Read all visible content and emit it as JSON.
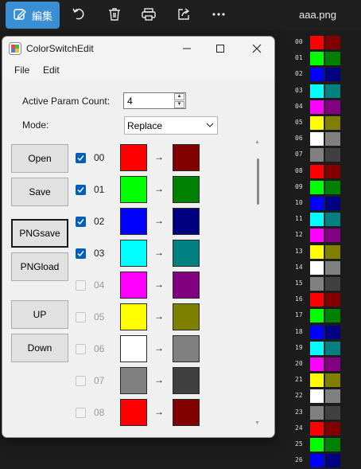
{
  "toolbar": {
    "edit_label": "編集",
    "filename": "aaa.png",
    "icons": [
      "edit-icon",
      "rotate-icon",
      "delete-icon",
      "print-icon",
      "share-icon",
      "more-icon"
    ]
  },
  "strip": {
    "rows": [
      {
        "num": "00",
        "a": "#ff0000",
        "b": "#800000"
      },
      {
        "num": "01",
        "a": "#00ff00",
        "b": "#008000"
      },
      {
        "num": "02",
        "a": "#0000ff",
        "b": "#000080"
      },
      {
        "num": "03",
        "a": "#00ffff",
        "b": "#008080"
      },
      {
        "num": "04",
        "a": "#ff00ff",
        "b": "#800080"
      },
      {
        "num": "05",
        "a": "#ffff00",
        "b": "#808000"
      },
      {
        "num": "06",
        "a": "#ffffff",
        "b": "#808080"
      },
      {
        "num": "07",
        "a": "#808080",
        "b": "#404040"
      },
      {
        "num": "08",
        "a": "#ff0000",
        "b": "#800000"
      },
      {
        "num": "09",
        "a": "#00ff00",
        "b": "#008000"
      },
      {
        "num": "10",
        "a": "#0000ff",
        "b": "#000080"
      },
      {
        "num": "11",
        "a": "#00ffff",
        "b": "#008080"
      },
      {
        "num": "12",
        "a": "#ff00ff",
        "b": "#800080"
      },
      {
        "num": "13",
        "a": "#ffff00",
        "b": "#808000"
      },
      {
        "num": "14",
        "a": "#ffffff",
        "b": "#808080"
      },
      {
        "num": "15",
        "a": "#808080",
        "b": "#404040"
      },
      {
        "num": "16",
        "a": "#ff0000",
        "b": "#800000"
      },
      {
        "num": "17",
        "a": "#00ff00",
        "b": "#008000"
      },
      {
        "num": "18",
        "a": "#0000ff",
        "b": "#000080"
      },
      {
        "num": "19",
        "a": "#00ffff",
        "b": "#008080"
      },
      {
        "num": "20",
        "a": "#ff00ff",
        "b": "#800080"
      },
      {
        "num": "21",
        "a": "#ffff00",
        "b": "#808000"
      },
      {
        "num": "22",
        "a": "#ffffff",
        "b": "#808080"
      },
      {
        "num": "23",
        "a": "#808080",
        "b": "#404040"
      },
      {
        "num": "24",
        "a": "#ff0000",
        "b": "#800000"
      },
      {
        "num": "25",
        "a": "#00ff00",
        "b": "#008000"
      },
      {
        "num": "26",
        "a": "#0000ff",
        "b": "#000080"
      }
    ]
  },
  "window": {
    "title": "ColorSwitchEdit",
    "menu": [
      "File",
      "Edit"
    ],
    "active_param_label": "Active Param Count:",
    "active_param_value": "4",
    "mode_label": "Mode:",
    "mode_value": "Replace",
    "buttons": [
      "Open",
      "Save",
      "PNGsave",
      "PNGload",
      "UP",
      "Down"
    ],
    "arrow": "→",
    "rows": [
      {
        "index": "00",
        "checked": true,
        "from": "#ff0000",
        "to": "#800000"
      },
      {
        "index": "01",
        "checked": true,
        "from": "#00ff00",
        "to": "#008000"
      },
      {
        "index": "02",
        "checked": true,
        "from": "#0000ff",
        "to": "#000080"
      },
      {
        "index": "03",
        "checked": true,
        "from": "#00ffff",
        "to": "#008080"
      },
      {
        "index": "04",
        "checked": false,
        "from": "#ff00ff",
        "to": "#800080"
      },
      {
        "index": "05",
        "checked": false,
        "from": "#ffff00",
        "to": "#808000"
      },
      {
        "index": "06",
        "checked": false,
        "from": "#ffffff",
        "to": "#808080"
      },
      {
        "index": "07",
        "checked": false,
        "from": "#808080",
        "to": "#404040"
      },
      {
        "index": "08",
        "checked": false,
        "from": "#ff0000",
        "to": "#800000"
      }
    ]
  }
}
